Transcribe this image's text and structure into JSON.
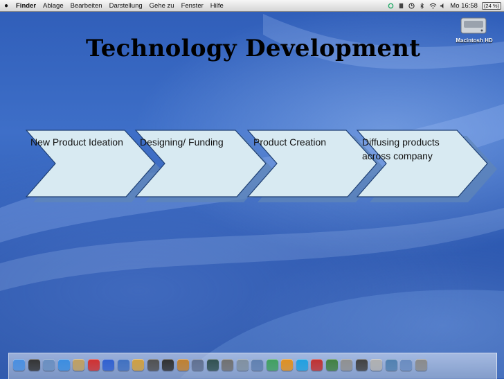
{
  "menubar": {
    "app_name": "Finder",
    "items": [
      "Ablage",
      "Bearbeiten",
      "Darstellung",
      "Gehe zu",
      "Fenster",
      "Hilfe"
    ],
    "clock": "Mo 16:58",
    "battery": "(24 %)"
  },
  "desktop": {
    "hd_label": "Macintosh HD"
  },
  "slide": {
    "title": "Technology Development",
    "steps": [
      {
        "label": "New Product Ideation"
      },
      {
        "label": "Designing/ Funding"
      },
      {
        "label": "Product Creation"
      },
      {
        "label": "Diffusing products across company"
      }
    ],
    "chevron_color": "#d8eaf2",
    "shadow_color": "#5f86b8"
  },
  "dock": {
    "items": [
      {
        "name": "finder-icon",
        "color": "#4a8fe0"
      },
      {
        "name": "dashboard-icon",
        "color": "#333333"
      },
      {
        "name": "network-icon",
        "color": "#6a8fc0"
      },
      {
        "name": "safari-icon",
        "color": "#3b8de0"
      },
      {
        "name": "mail-icon",
        "color": "#c0a060"
      },
      {
        "name": "calendar-icon",
        "color": "#d03030"
      },
      {
        "name": "ichat-icon",
        "color": "#3060d0"
      },
      {
        "name": "itunes-icon",
        "color": "#4070c0"
      },
      {
        "name": "iphoto-icon",
        "color": "#d0a040"
      },
      {
        "name": "imovie-icon",
        "color": "#505050"
      },
      {
        "name": "idvd-icon",
        "color": "#303030"
      },
      {
        "name": "garageband-icon",
        "color": "#c08030"
      },
      {
        "name": "spaces-icon",
        "color": "#607090"
      },
      {
        "name": "timemachine-icon",
        "color": "#305050"
      },
      {
        "name": "preferences-icon",
        "color": "#707070"
      },
      {
        "name": "utility-icon",
        "color": "#8090a0"
      },
      {
        "name": "script-icon",
        "color": "#6080b0"
      },
      {
        "name": "chart-icon",
        "color": "#40a060"
      },
      {
        "name": "tv-icon",
        "color": "#e09020"
      },
      {
        "name": "skype-icon",
        "color": "#20a0e0"
      },
      {
        "name": "target-icon",
        "color": "#c03030"
      },
      {
        "name": "plant-icon",
        "color": "#408040"
      },
      {
        "name": "scissors-icon",
        "color": "#909090"
      },
      {
        "name": "agent-icon",
        "color": "#404040"
      },
      {
        "name": "lamp-icon",
        "color": "#b0b0b0"
      },
      {
        "name": "quicktime-icon",
        "color": "#5080b0"
      },
      {
        "name": "downloads-icon",
        "color": "#6a8cc0"
      },
      {
        "name": "trash-icon",
        "color": "#8a8a8a"
      }
    ]
  }
}
